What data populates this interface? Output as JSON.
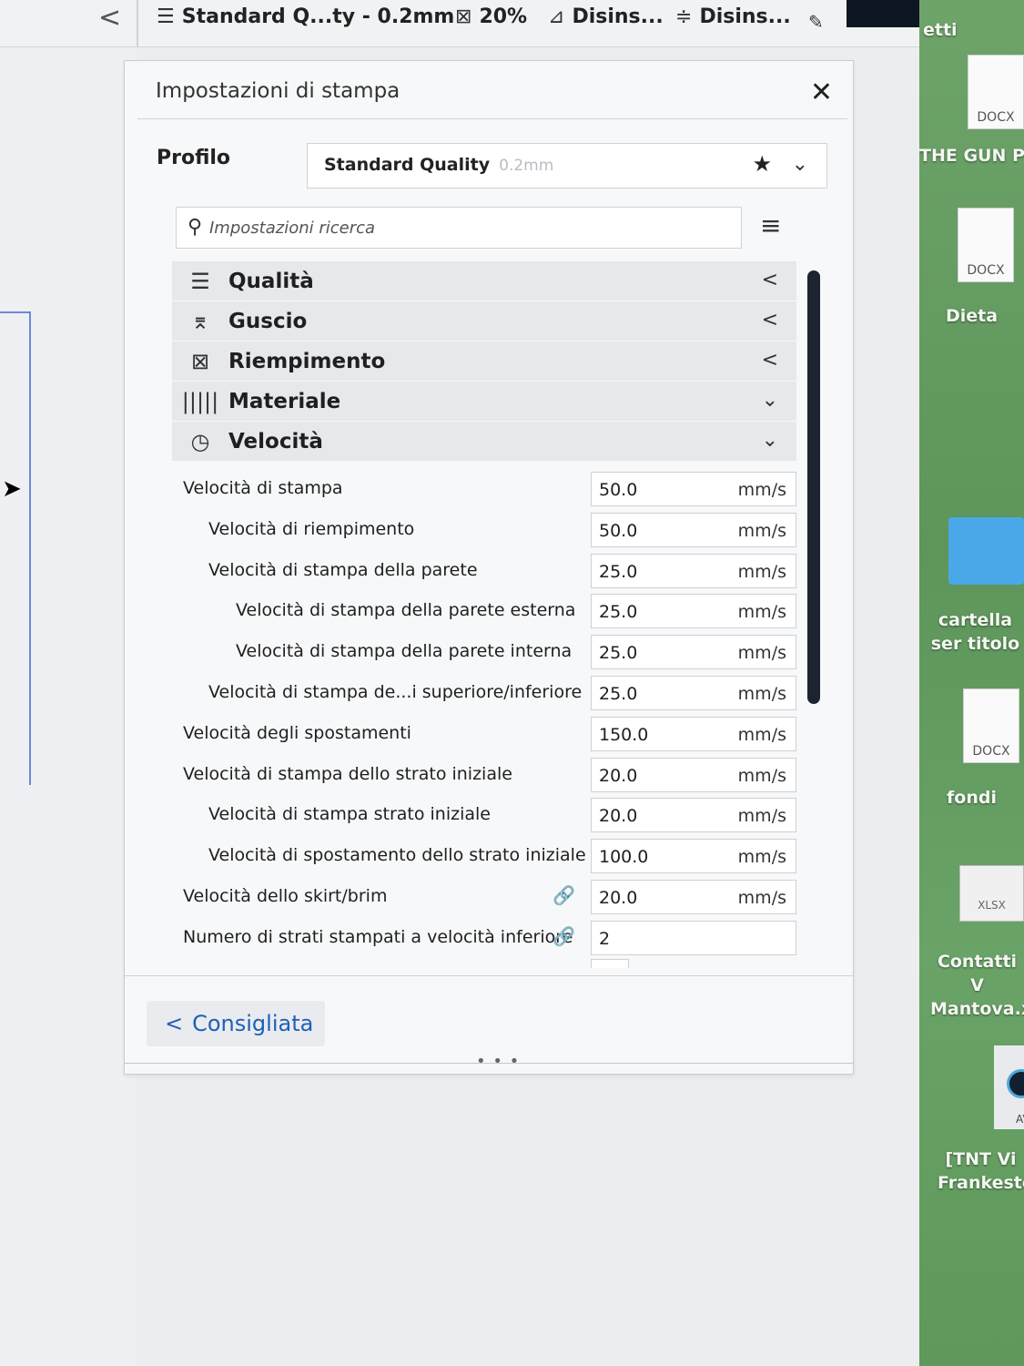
{
  "toolbar": {
    "back_label": "<",
    "profile_summary": "Standard Q...ty - 0.2mm",
    "infill_summary": "20%",
    "support_summary": "Disins...",
    "adhesion_summary": "Disins..."
  },
  "panel": {
    "title": "Impostazioni di stampa",
    "close_label": "✕",
    "profile_label": "Profilo",
    "profile_name": "Standard Quality",
    "profile_detail": "0.2mm",
    "search_placeholder": "Impostazioni ricerca",
    "recommended_label": "Consigliata"
  },
  "categories": [
    {
      "label": "Qualità",
      "icon": "quality-icon",
      "expanded": false
    },
    {
      "label": "Guscio",
      "icon": "shell-icon",
      "expanded": false
    },
    {
      "label": "Riempimento",
      "icon": "infill-icon",
      "expanded": false
    },
    {
      "label": "Materiale",
      "icon": "material-icon",
      "expanded": true
    },
    {
      "label": "Velocità",
      "icon": "speed-icon",
      "expanded": true
    }
  ],
  "settings": [
    {
      "label": "Velocità di stampa",
      "value": "50.0",
      "unit": "mm/s",
      "indent": 0
    },
    {
      "label": "Velocità di riempimento",
      "value": "50.0",
      "unit": "mm/s",
      "indent": 1
    },
    {
      "label": "Velocità di stampa della parete",
      "value": "25.0",
      "unit": "mm/s",
      "indent": 1
    },
    {
      "label": "Velocità di stampa della parete esterna",
      "value": "25.0",
      "unit": "mm/s",
      "indent": 2
    },
    {
      "label": "Velocità di stampa della parete interna",
      "value": "25.0",
      "unit": "mm/s",
      "indent": 2
    },
    {
      "label": "Velocità di stampa de...i superiore/inferiore",
      "value": "25.0",
      "unit": "mm/s",
      "indent": 1
    },
    {
      "label": "Velocità degli spostamenti",
      "value": "150.0",
      "unit": "mm/s",
      "indent": 0
    },
    {
      "label": "Velocità di stampa dello strato iniziale",
      "value": "20.0",
      "unit": "mm/s",
      "indent": 0
    },
    {
      "label": "Velocità di stampa strato iniziale",
      "value": "20.0",
      "unit": "mm/s",
      "indent": 1
    },
    {
      "label": "Velocità di spostamento dello strato iniziale",
      "value": "100.0",
      "unit": "mm/s",
      "indent": 1
    },
    {
      "label": "Velocità dello skirt/brim",
      "value": "20.0",
      "unit": "mm/s",
      "indent": 0,
      "linked": true
    },
    {
      "label": "Numero di strati stampati a velocità inferiore",
      "value": "2",
      "unit": "",
      "indent": 0,
      "linked": true
    }
  ],
  "desktop": {
    "top_label": "etti",
    "items": [
      {
        "tag": "DOCX",
        "label": "THE GUN PRESEN...RD"
      },
      {
        "tag": "DOCX",
        "label": "Dieta"
      },
      {
        "tag": "",
        "label": "cartella ser titolo"
      },
      {
        "tag": "DOCX",
        "label": "fondi"
      },
      {
        "tag": "XLSX",
        "label": "Contatti V Mantova.x"
      },
      {
        "tag": "AV",
        "label": "[TNT Vi Frankeste"
      }
    ]
  }
}
